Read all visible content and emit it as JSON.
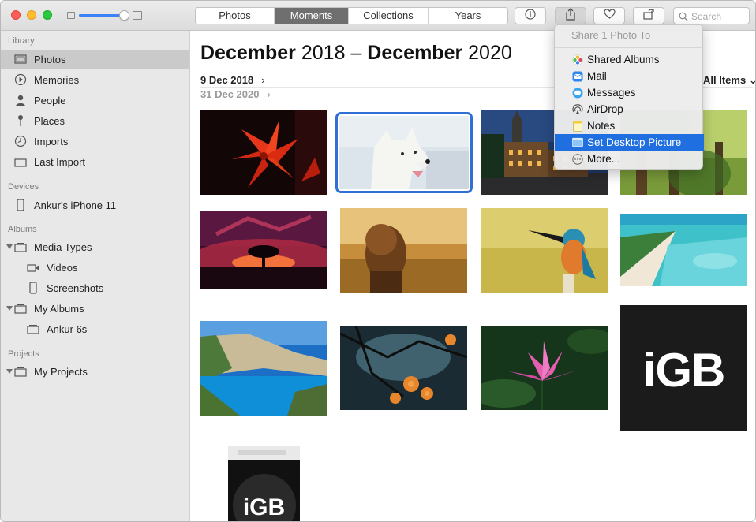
{
  "toolbar": {
    "tabs": [
      "Photos",
      "Moments",
      "Collections",
      "Years"
    ],
    "active_tab": "Moments",
    "search_placeholder": "Search"
  },
  "sidebar": {
    "library_label": "Library",
    "library_items": [
      "Photos",
      "Memories",
      "People",
      "Places",
      "Imports",
      "Last Import"
    ],
    "devices_label": "Devices",
    "device_items": [
      "Ankur's iPhone 11"
    ],
    "albums_label": "Albums",
    "media_types": "Media Types",
    "videos": "Videos",
    "screenshots": "Screenshots",
    "my_albums": "My Albums",
    "ankur_6s": "Ankur 6s",
    "projects_label": "Projects",
    "my_projects": "My Projects"
  },
  "main": {
    "title_from_month": "December",
    "title_from_year": "2018",
    "title_dash": "–",
    "title_to_month": "December",
    "title_to_year": "2020",
    "date_from": "9 Dec 2018",
    "date_to": "31 Dec 2020",
    "all_items": "All Items",
    "photos": [
      "red-amaryllis-flower",
      "white-dog",
      "old-town-at-night",
      "forest-trees",
      "sunset-tree-silhouette",
      "girl-in-golden-field",
      "kingfisher-bird",
      "tropical-beach",
      "navagio-beach-cliffs",
      "orange-blossoms",
      "pink-lotus",
      "igb-logo-tile",
      "igb-phone-screenshot"
    ],
    "igb_text": "iGB"
  },
  "share_menu": {
    "title": "Share 1 Photo To",
    "items": [
      "Shared Albums",
      "Mail",
      "Messages",
      "AirDrop",
      "Notes",
      "Set Desktop Picture",
      "More..."
    ],
    "highlighted": "Set Desktop Picture"
  },
  "colors": {
    "accent": "#1f6fe0",
    "selection_outline": "#2f6fd6",
    "sidebar_bg": "#e8e8e8"
  }
}
